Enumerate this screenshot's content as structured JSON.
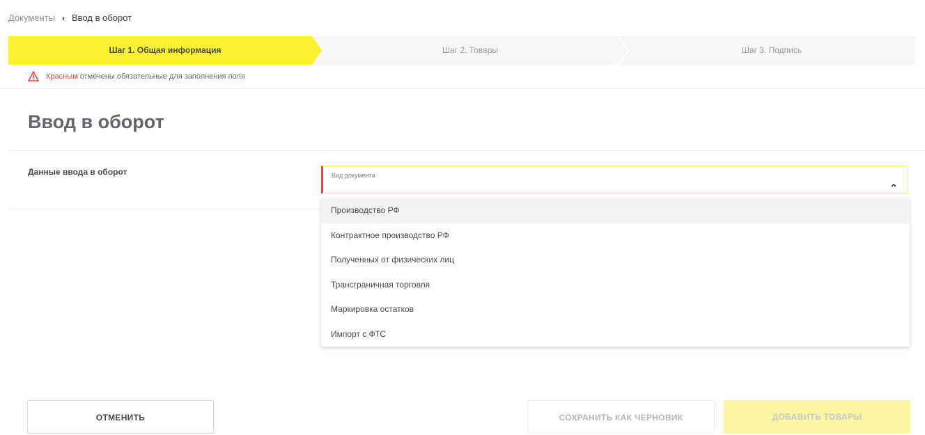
{
  "breadcrumb": {
    "parent": "Документы",
    "separator": "›",
    "current": "Ввод в оборот"
  },
  "steps": [
    {
      "label": "Шаг 1. Общая информация",
      "active": true
    },
    {
      "label": "Шаг 2. Товары",
      "active": false
    },
    {
      "label": "Шаг 3. Подпись",
      "active": false
    }
  ],
  "notice": {
    "highlight": "Красным",
    "text": " отмечены обязательные для заполнения поля"
  },
  "page_title": "Ввод в оборот",
  "section_label": "Данные ввода в оборот",
  "document_type": {
    "label": "Вид документа",
    "value": "",
    "options": [
      "Производство РФ",
      "Контрактное производство РФ",
      "Полученных от физических лиц",
      "Трансграничная торговля",
      "Маркировка остатков",
      "Импорт с ФТС"
    ]
  },
  "buttons": {
    "cancel": "ОТМЕНИТЬ",
    "save_draft": "СОХРАНИТЬ КАК ЧЕРНОВИК",
    "add_goods": "ДОБАВИТЬ ТОВАРЫ"
  },
  "colors": {
    "accent_yellow": "#f8f232",
    "required_red": "#e8423e"
  },
  "icons": {
    "warning": "warning-triangle-icon",
    "chevron": "chevron-up-icon",
    "breadcrumb_separator": "chevron-right-icon"
  }
}
